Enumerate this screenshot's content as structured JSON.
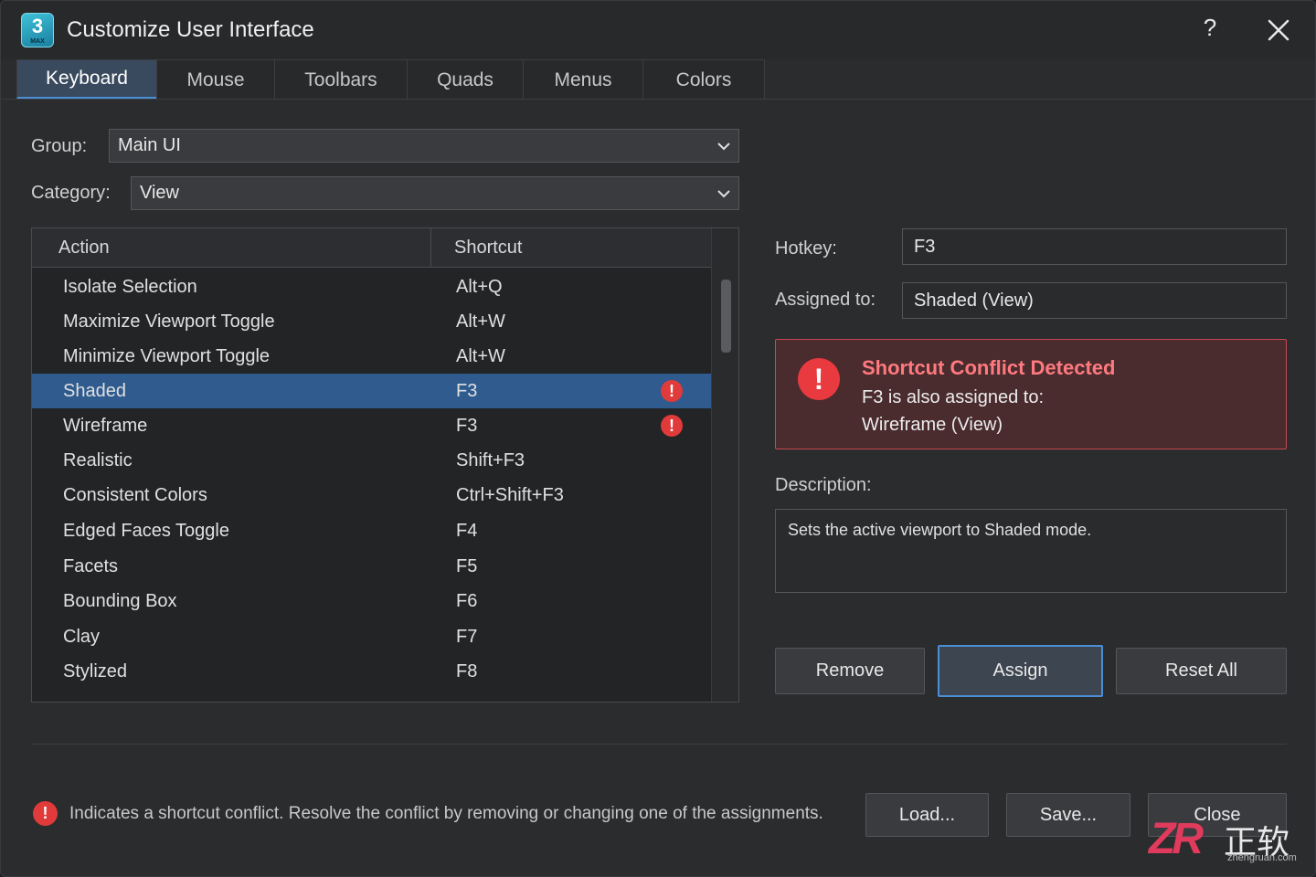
{
  "window": {
    "title": "Customize User Interface",
    "app_icon": {
      "number": "3",
      "text": "MAX"
    },
    "help_label": "?",
    "close_icon": "close-icon"
  },
  "tabs": [
    {
      "label": "Keyboard",
      "active": true
    },
    {
      "label": "Mouse",
      "active": false
    },
    {
      "label": "Toolbars",
      "active": false
    },
    {
      "label": "Quads",
      "active": false
    },
    {
      "label": "Menus",
      "active": false
    },
    {
      "label": "Colors",
      "active": false
    }
  ],
  "group": {
    "label": "Group:",
    "value": "Main UI"
  },
  "category": {
    "label": "Category:",
    "value": "View"
  },
  "table": {
    "headers": {
      "action": "Action",
      "shortcut": "Shortcut"
    },
    "rows": [
      {
        "action": "Isolate Selection",
        "shortcut": "Alt+Q",
        "conflict": false,
        "selected": false
      },
      {
        "action": "Maximize Viewport Toggle",
        "shortcut": "Alt+W",
        "conflict": false,
        "selected": false
      },
      {
        "action": "Minimize Viewport Toggle",
        "shortcut": "Alt+W",
        "conflict": false,
        "selected": false
      },
      {
        "action": "Shaded",
        "shortcut": "F3",
        "conflict": true,
        "selected": true
      },
      {
        "action": "Wireframe",
        "shortcut": "F3",
        "conflict": true,
        "selected": false
      },
      {
        "action": "Realistic",
        "shortcut": "Shift+F3",
        "conflict": false,
        "selected": false
      },
      {
        "action": "Consistent Colors",
        "shortcut": "Ctrl+Shift+F3",
        "conflict": false,
        "selected": false
      },
      {
        "action": "Edged Faces Toggle",
        "shortcut": "F4",
        "conflict": false,
        "selected": false
      },
      {
        "action": "Facets",
        "shortcut": "F5",
        "conflict": false,
        "selected": false
      },
      {
        "action": "Bounding Box",
        "shortcut": "F6",
        "conflict": false,
        "selected": false
      },
      {
        "action": "Clay",
        "shortcut": "F7",
        "conflict": false,
        "selected": false
      },
      {
        "action": "Stylized",
        "shortcut": "F8",
        "conflict": false,
        "selected": false
      }
    ]
  },
  "hotkey": {
    "label": "Hotkey:",
    "value": "F3"
  },
  "assigned_to": {
    "label": "Assigned to:",
    "value": "Shaded (View)"
  },
  "conflict": {
    "title": "Shortcut Conflict Detected",
    "line1": "F3 is also assigned to:",
    "line2": "Wireframe (View)",
    "icon": "!"
  },
  "description": {
    "label": "Description:",
    "text": "Sets the active viewport to Shaded mode."
  },
  "actions": {
    "remove": "Remove",
    "assign": "Assign",
    "reset_all": "Reset All"
  },
  "footer": {
    "note": "Indicates a shortcut conflict.  Resolve the conflict by removing or changing one of the assignments.",
    "icon": "!",
    "load": "Load...",
    "save": "Save...",
    "close": "Close"
  },
  "watermark": {
    "logo": "ZR",
    "cn": "正软",
    "url": "zhengruan.com"
  },
  "colors": {
    "accent": "#4a8fd6",
    "selected_row": "#2f5b8f",
    "conflict": "#e03a3a",
    "conflict_bg": "#4a2b2e",
    "conflict_title": "#ff7a7f"
  }
}
